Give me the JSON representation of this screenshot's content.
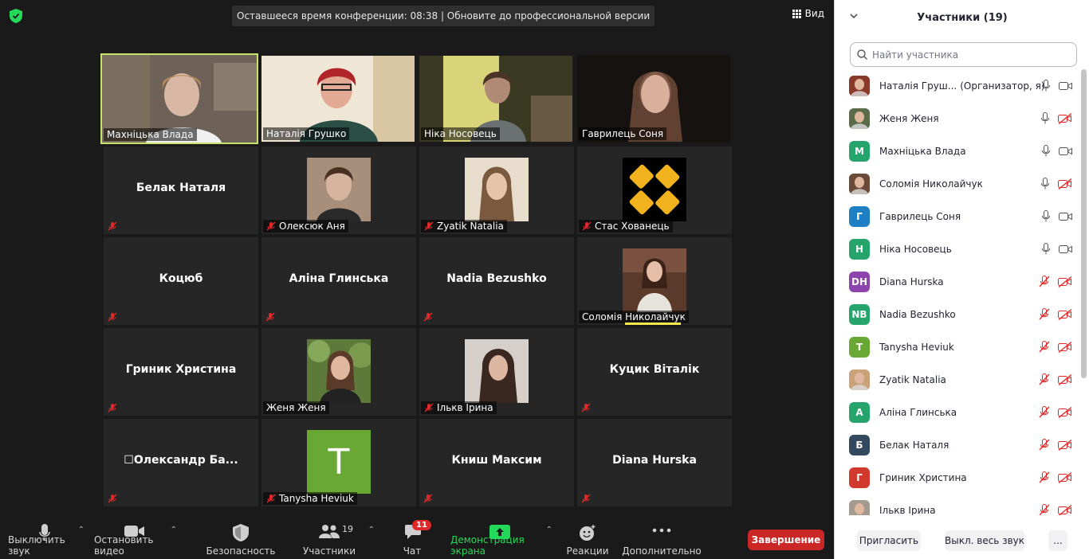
{
  "banner": "Оставшееся время конференции: 08:38 | Обновите до профессиональной версии",
  "view_label": "Вид",
  "tiles": [
    {
      "name": "Махніцька Влада"
    },
    {
      "name": "Наталія Грушко"
    },
    {
      "name": "Ніка Носовець"
    },
    {
      "name": "Гаврилець Соня"
    },
    {
      "name": "Белак Наталя"
    },
    {
      "name": "Олексюк Аня"
    },
    {
      "name": "Zyatik Natalia"
    },
    {
      "name": "Стас Хованець"
    },
    {
      "name": "Коцюб"
    },
    {
      "name": "Аліна Глинська"
    },
    {
      "name": "Nadia Bezushko"
    },
    {
      "name": "Соломія Николайчук"
    },
    {
      "name": "Гриник Христина"
    },
    {
      "name": "Женя Женя"
    },
    {
      "name": "Ількв Ірина"
    },
    {
      "name": "Куцик Віталік"
    },
    {
      "name": "☐Олександр  Ба..."
    },
    {
      "name": "Tanysha Heviuk",
      "initial": "T"
    },
    {
      "name": "Книш Максим"
    },
    {
      "name": "Diana Hurska"
    }
  ],
  "toolbar": {
    "mute": "Выключить звук",
    "video": "Остановить видео",
    "security": "Безопасность",
    "participants": "Участники",
    "participants_count": "19",
    "chat": "Чат",
    "chat_badge": "11",
    "share": "Демонстрация экрана",
    "reactions": "Реакции",
    "more": "Дополнительно",
    "end": "Завершение"
  },
  "panel": {
    "title": "Участники (19)",
    "search_placeholder": "Найти участника",
    "participants": [
      {
        "name": "Наталія Груш...",
        "role": "(Организатор, я)",
        "avatar": "photo",
        "color": "#8a3a2a"
      },
      {
        "name": "Женя Женя",
        "avatar": "photo",
        "color": "#5a6b4a"
      },
      {
        "name": "Махніцька Влада",
        "initial": "М",
        "color": "#25a56b"
      },
      {
        "name": "Соломія Николайчук",
        "avatar": "photo",
        "color": "#6b4a3a"
      },
      {
        "name": "Гаврилець Соня",
        "initial": "Г",
        "color": "#1d7fc4"
      },
      {
        "name": "Ніка Носовець",
        "initial": "Н",
        "color": "#25a56b"
      },
      {
        "name": "Diana Hurska",
        "initial": "DH",
        "color": "#8e44ad"
      },
      {
        "name": "Nadia Bezushko",
        "initial": "NB",
        "color": "#25a56b"
      },
      {
        "name": "Tanysha Heviuk",
        "initial": "T",
        "color": "#6aa836"
      },
      {
        "name": "Zyatik Natalia",
        "avatar": "photo",
        "color": "#c9a27a"
      },
      {
        "name": "Аліна Глинська",
        "initial": "А",
        "color": "#25a56b"
      },
      {
        "name": "Белак Наталя",
        "initial": "Б",
        "color": "#34495e"
      },
      {
        "name": "Гриник Христина",
        "initial": "Г",
        "color": "#d0392b"
      },
      {
        "name": "Ількв Ірина",
        "avatar": "photo",
        "color": "#a59a90"
      }
    ],
    "invite": "Пригласить",
    "mute_all": "Выкл. весь звук",
    "more": "..."
  }
}
